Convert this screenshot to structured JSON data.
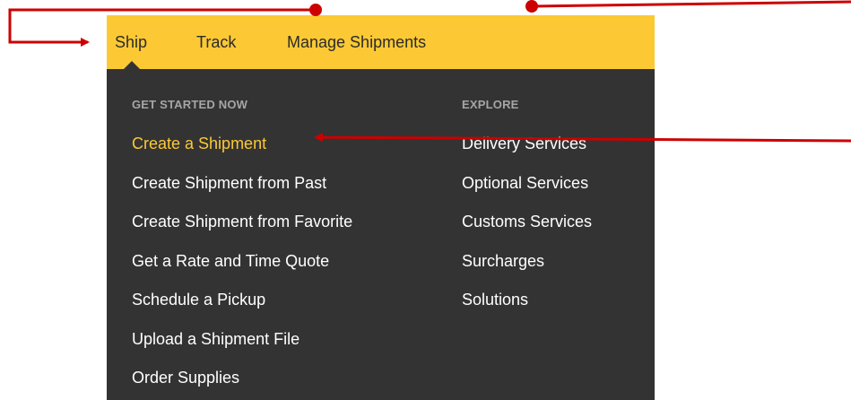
{
  "nav": {
    "items": [
      {
        "label": "Ship"
      },
      {
        "label": "Track"
      },
      {
        "label": "Manage Shipments"
      }
    ]
  },
  "menu": {
    "get_started": {
      "heading": "GET STARTED NOW",
      "items": [
        {
          "label": "Create a Shipment",
          "active": true
        },
        {
          "label": "Create Shipment from Past"
        },
        {
          "label": "Create Shipment from Favorite"
        },
        {
          "label": "Get a Rate and Time Quote"
        },
        {
          "label": "Schedule a Pickup"
        },
        {
          "label": "Upload a Shipment File"
        },
        {
          "label": "Order Supplies"
        }
      ]
    },
    "explore": {
      "heading": "EXPLORE",
      "items": [
        {
          "label": "Delivery Services"
        },
        {
          "label": "Optional Services"
        },
        {
          "label": "Customs Services"
        },
        {
          "label": "Surcharges"
        },
        {
          "label": "Solutions"
        }
      ]
    }
  },
  "colors": {
    "brand_yellow": "#fcc934",
    "menu_bg": "#333333",
    "annotation_red": "#cc0000"
  }
}
